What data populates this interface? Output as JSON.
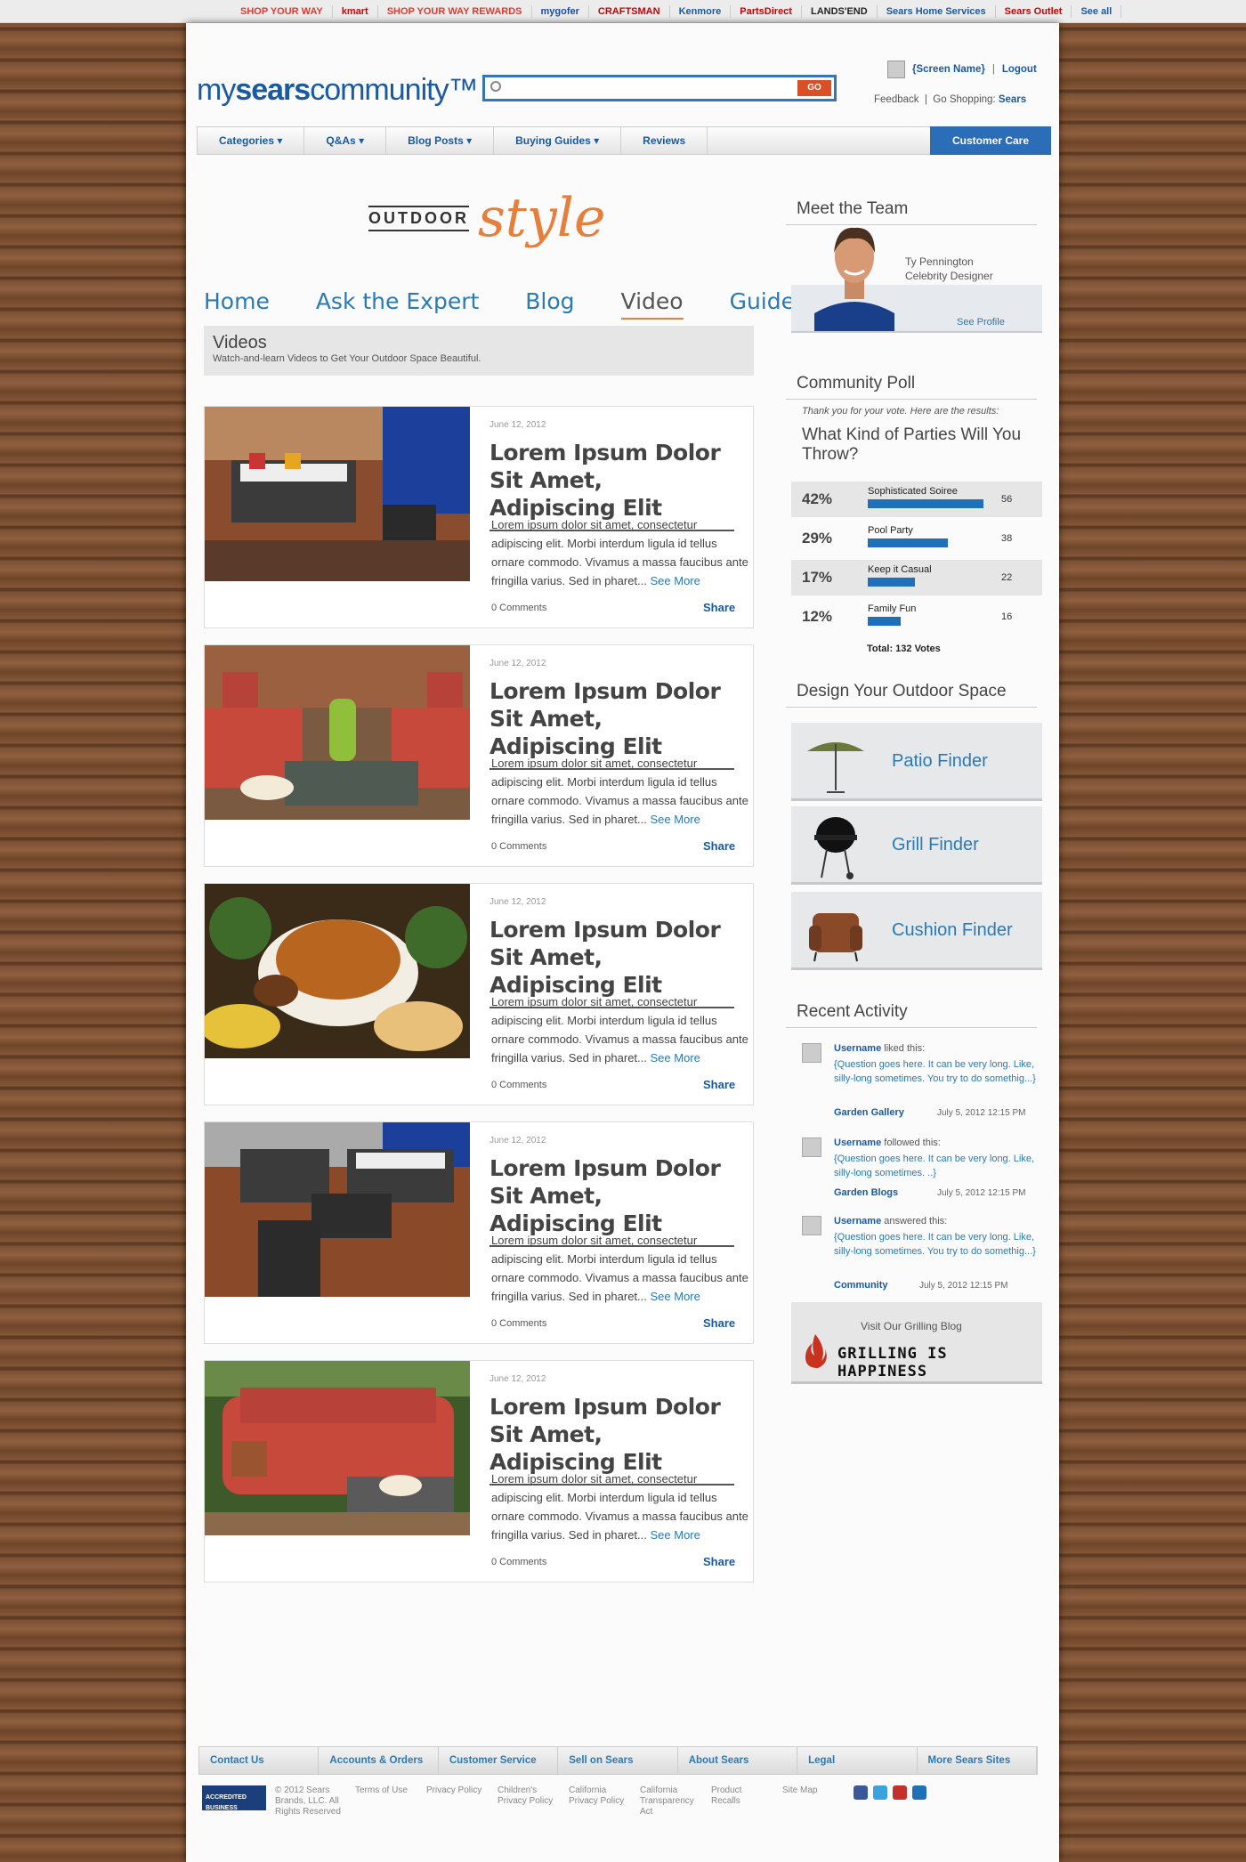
{
  "topbar": {
    "sites": [
      "SHOP YOUR WAY",
      "kmart",
      "SHOP YOUR WAY REWARDS",
      "mygofer",
      "CRAFTSMAN",
      "Kenmore",
      "PartsDirect",
      "LANDS'END",
      "Sears Home Services",
      "Sears Outlet",
      "See all"
    ]
  },
  "header": {
    "logo_my": "my",
    "logo_sears": "sears",
    "logo_community": "community™",
    "search_placeholder": "",
    "go": "GO",
    "screen_name": "{Screen Name}",
    "sep": "|",
    "logout": "Logout",
    "feedback": "Feedback",
    "go_shopping": "Go Shopping:",
    "sears": "Sears"
  },
  "nav": {
    "items": [
      "Categories ▾",
      "Q&As ▾",
      "Blog Posts ▾",
      "Buying Guides ▾",
      "Reviews"
    ],
    "care": "Customer Care"
  },
  "brand": {
    "outdoor": "OUTDOOR",
    "style": "style"
  },
  "subnav": {
    "items": [
      "Home",
      "Ask the Expert",
      "Blog",
      "Video",
      "Guides"
    ]
  },
  "videos": {
    "title": "Videos",
    "desc": "Watch-and-learn Videos to Get Your Outdoor Space Beautiful."
  },
  "cards": [
    {
      "date": "June 12, 2012",
      "title": "Lorem Ipsum Dolor Sit Amet, Adipiscing Elit",
      "body": "Lorem ipsum dolor sit amet, consectetur adipiscing elit. Morbi interdum ligula id tellus ornare commodo. Vivamus a massa faucibus ante fringilla varius. Sed in pharet...",
      "more": "See More",
      "comments": "0 Comments",
      "share": "Share"
    },
    {
      "date": "June 12, 2012",
      "title": "Lorem Ipsum Dolor Sit Amet, Adipiscing Elit",
      "body": "Lorem ipsum dolor sit amet, consectetur adipiscing elit. Morbi interdum ligula id tellus ornare commodo. Vivamus a massa faucibus ante fringilla varius. Sed in pharet...",
      "more": "See More",
      "comments": "0 Comments",
      "share": "Share"
    },
    {
      "date": "June 12, 2012",
      "title": "Lorem Ipsum Dolor Sit Amet, Adipiscing Elit",
      "body": "Lorem ipsum dolor sit amet, consectetur adipiscing elit. Morbi interdum ligula id tellus ornare commodo. Vivamus a massa faucibus ante fringilla varius. Sed in pharet...",
      "more": "See More",
      "comments": "0 Comments",
      "share": "Share"
    },
    {
      "date": "June 12, 2012",
      "title": "Lorem Ipsum Dolor Sit Amet, Adipiscing Elit",
      "body": "Lorem ipsum dolor sit amet, consectetur adipiscing elit. Morbi interdum ligula id tellus ornare commodo. Vivamus a massa faucibus ante fringilla varius. Sed in pharet...",
      "more": "See More",
      "comments": "0 Comments",
      "share": "Share"
    },
    {
      "date": "June 12, 2012",
      "title": "Lorem Ipsum Dolor Sit Amet, Adipiscing Elit",
      "body": "Lorem ipsum dolor sit amet, consectetur adipiscing elit. Morbi interdum ligula id tellus ornare commodo. Vivamus a massa faucibus ante fringilla varius. Sed in pharet...",
      "more": "See More",
      "comments": "0 Comments",
      "share": "Share"
    }
  ],
  "team": {
    "title": "Meet the Team",
    "name": "Ty Pennington",
    "role": "Celebrity Designer",
    "profile": "See Profile"
  },
  "poll": {
    "title": "Community Poll",
    "thanks": "Thank you for your vote. Here are the results:",
    "question": "What Kind of Parties Will You Throw?",
    "rows": [
      {
        "pct": "42%",
        "label": "Sophisticated Soiree",
        "count": "56",
        "fraction": 0.42
      },
      {
        "pct": "29%",
        "label": "Pool Party",
        "count": "38",
        "fraction": 0.29
      },
      {
        "pct": "17%",
        "label": "Keep it Casual",
        "count": "22",
        "fraction": 0.17
      },
      {
        "pct": "12%",
        "label": "Family Fun",
        "count": "16",
        "fraction": 0.12
      }
    ],
    "total": "Total: 132 Votes"
  },
  "design": {
    "title": "Design Your Outdoor Space",
    "finders": [
      "Patio Finder",
      "Grill Finder",
      "Cushion Finder"
    ]
  },
  "activity": {
    "title": "Recent Activity",
    "items": [
      {
        "user": "Username",
        "verb": "liked this:",
        "q": "{Question goes here. It can be very long. Like, silly-long sometimes. You try to do somethig...}",
        "src": "Garden Gallery",
        "ts": "July 5, 2012 12:15 PM"
      },
      {
        "user": "Username",
        "verb": "followed this:",
        "q": "{Question goes here. It can be very long. Like, silly-long sometimes. ..}",
        "src": "Garden Blogs",
        "ts": "July 5, 2012 12:15 PM"
      },
      {
        "user": "Username",
        "verb": "answered this:",
        "q": "{Question goes here. It can be very long. Like, silly-long sometimes. You try to do somethig...}",
        "src": "Community",
        "ts": "July 5, 2012 12:15 PM"
      }
    ]
  },
  "grill": {
    "visit": "Visit Our Grilling Blog",
    "logo": "GRILLING IS HAPPINESS"
  },
  "footer": {
    "nav": [
      "Contact Us",
      "Accounts & Orders",
      "Customer Service",
      "Sell on Sears",
      "About Sears",
      "Legal",
      "More Sears Sites"
    ],
    "bbb": "ACCREDITED BUSINESS",
    "copyright": "© 2012 Sears Brands, LLC. All Rights Reserved",
    "links": [
      "Terms of Use",
      "Privacy Policy",
      "Children's Privacy Policy",
      "California Privacy Policy",
      "California Transparency Act",
      "Product Recalls",
      "Site Map"
    ]
  }
}
